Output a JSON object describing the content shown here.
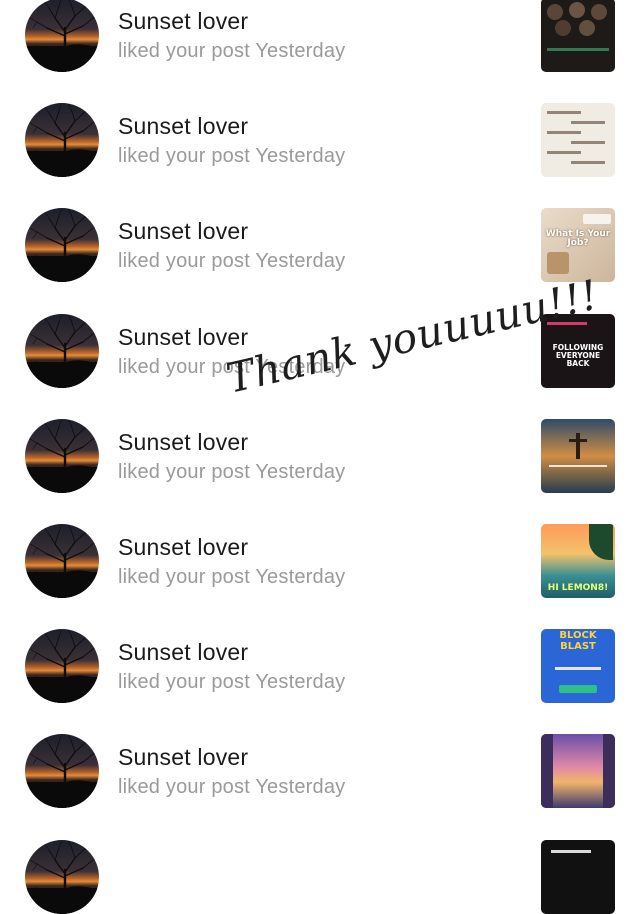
{
  "notifications": [
    {
      "name": "Sunset lover",
      "action": "liked your post Yesterday",
      "thumbnail": {
        "theme": "dark-brown-balls",
        "text": ""
      }
    },
    {
      "name": "Sunset lover",
      "action": "liked your post Yesterday",
      "thumbnail": {
        "theme": "beige-text-list",
        "text": ""
      }
    },
    {
      "name": "Sunset lover",
      "action": "liked your post Yesterday",
      "thumbnail": {
        "theme": "desk-tan",
        "text": "What Is Your Job?"
      }
    },
    {
      "name": "Sunset lover",
      "action": "liked your post Yesterday",
      "thumbnail": {
        "theme": "dark-text",
        "text": "FOLLOWING EVERYONE BACK"
      }
    },
    {
      "name": "Sunset lover",
      "action": "liked your post Yesterday",
      "thumbnail": {
        "theme": "cross-sunset",
        "text": ""
      }
    },
    {
      "name": "Sunset lover",
      "action": "liked your post Yesterday",
      "thumbnail": {
        "theme": "beach-palm",
        "text": "HI LEMON8!"
      }
    },
    {
      "name": "Sunset lover",
      "action": "liked your post Yesterday",
      "thumbnail": {
        "theme": "blue-block-blast",
        "text": "BLOCK BLAST"
      }
    },
    {
      "name": "Sunset lover",
      "action": "liked your post Yesterday",
      "thumbnail": {
        "theme": "pink-sky",
        "text": ""
      }
    },
    {
      "name": "",
      "action": "",
      "thumbnail": {
        "theme": "black-partial",
        "text": ""
      }
    }
  ],
  "overlay_text": "Thank youuuuu!!!",
  "colors": {
    "name": "#1b1b1b",
    "secondary": "#9a9a9a",
    "background": "#ffffff"
  }
}
